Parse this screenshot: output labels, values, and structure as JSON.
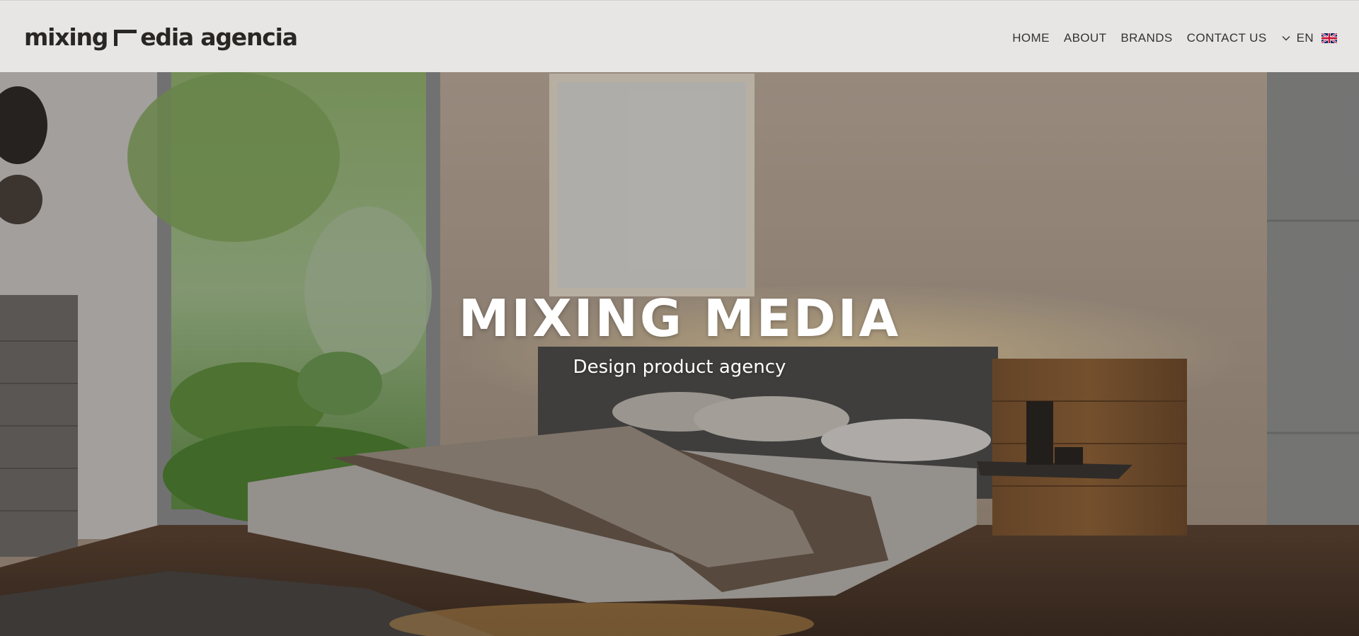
{
  "header": {
    "logo_left": "mixing",
    "logo_right": "edia agencia",
    "nav": [
      {
        "label": "HOME"
      },
      {
        "label": "ABOUT"
      },
      {
        "label": "BRANDS"
      },
      {
        "label": "CONTACT US"
      }
    ],
    "language": {
      "code": "EN",
      "flag_icon": "uk-flag-icon",
      "dropdown_icon": "chevron-down-icon"
    }
  },
  "hero": {
    "title": "MIXING MEDIA",
    "subtitle": "Design product agency"
  },
  "colors": {
    "header_bg": "#e7e6e4",
    "nav_text": "#333333",
    "hero_text": "#ffffff",
    "logo": "#2a2624"
  }
}
